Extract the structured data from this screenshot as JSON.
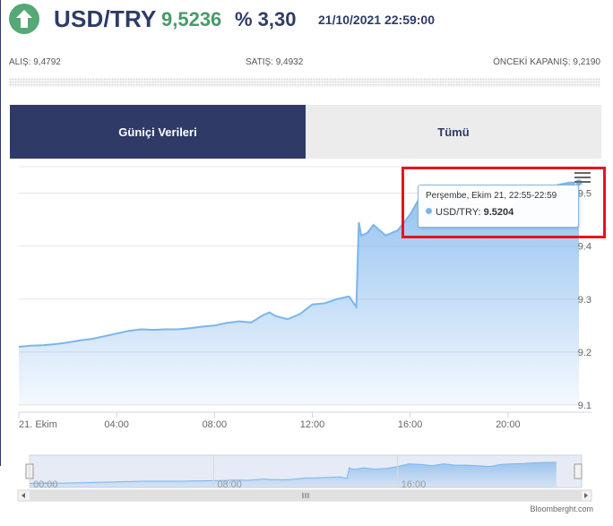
{
  "header": {
    "arrow_icon": "up-arrow-icon",
    "pair": "USD/TRY",
    "price": "9,5236",
    "change": "% 3,30",
    "datetime": "21/10/2021 22:59:00",
    "colors": {
      "up": "#56a876",
      "navy": "#2f3b66"
    }
  },
  "quotes": {
    "bid": "ALIŞ: 9,4792",
    "ask": "SATIŞ: 9,4932",
    "prev_close": "ÖNCEKİ KAPANIŞ: 9,2190"
  },
  "tabs": [
    {
      "label": "Güniçi Verileri",
      "active": true
    },
    {
      "label": "Tümü",
      "active": false
    }
  ],
  "tooltip": {
    "date": "Perşembe, Ekim 21, 22:55-22:59",
    "series": "USD/TRY:",
    "value": "9.5204"
  },
  "credit": "Bloomberght.com",
  "chart_data": {
    "type": "area",
    "series": [
      {
        "name": "USD/TRY"
      }
    ],
    "x_hours": [
      0,
      0.5,
      1,
      1.5,
      2,
      2.5,
      3,
      3.5,
      4,
      4.5,
      5,
      5.5,
      6,
      6.5,
      7,
      7.5,
      8,
      8.5,
      9,
      9.5,
      10,
      10.25,
      10.5,
      10.75,
      11,
      11.5,
      12,
      12.5,
      13,
      13.5,
      13.8,
      13.9,
      14,
      14.25,
      14.5,
      14.75,
      15,
      15.5,
      16,
      16.5,
      17,
      17.5,
      18,
      18.5,
      19,
      19.5,
      20,
      20.5,
      21,
      21.5,
      22,
      22.5,
      22.9
    ],
    "y_values": [
      9.21,
      9.212,
      9.213,
      9.215,
      9.218,
      9.222,
      9.225,
      9.23,
      9.235,
      9.24,
      9.243,
      9.242,
      9.243,
      9.243,
      9.245,
      9.248,
      9.25,
      9.255,
      9.258,
      9.256,
      9.27,
      9.275,
      9.268,
      9.265,
      9.262,
      9.272,
      9.29,
      9.292,
      9.3,
      9.305,
      9.285,
      9.445,
      9.42,
      9.425,
      9.44,
      9.43,
      9.42,
      9.43,
      9.46,
      9.5,
      9.49,
      9.47,
      9.5,
      9.48,
      9.48,
      9.47,
      9.46,
      9.49,
      9.5,
      9.505,
      9.515,
      9.52,
      9.52
    ],
    "x_ticks": [
      "21. Ekim",
      "04:00",
      "08:00",
      "12:00",
      "16:00",
      "20:00"
    ],
    "y_ticks": [
      "9.1",
      "9.2",
      "9.3",
      "9.4",
      "9.5"
    ],
    "ylim": [
      9.1,
      9.55
    ],
    "navigator_ticks": [
      "00:00",
      "08:00",
      "16:00"
    ],
    "grid": true
  }
}
